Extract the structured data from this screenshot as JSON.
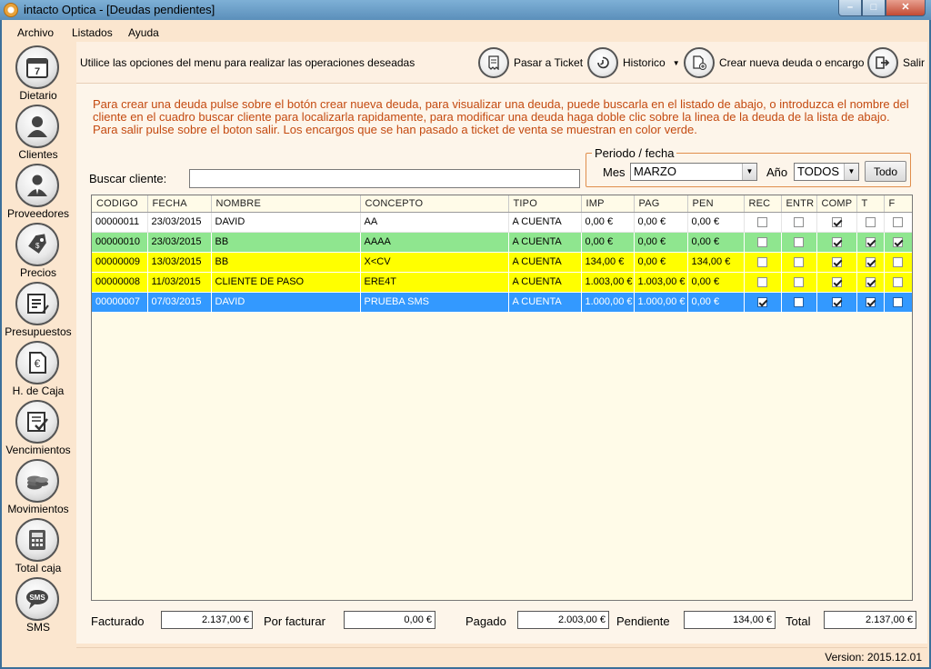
{
  "window": {
    "title": "intacto Optica - [Deudas pendientes]"
  },
  "menu": [
    "Archivo",
    "Listados",
    "Ayuda"
  ],
  "sidebar": [
    {
      "label": "Dietario",
      "icon": "calendar-icon"
    },
    {
      "label": "Clientes",
      "icon": "person-icon"
    },
    {
      "label": "Proveedores",
      "icon": "businessman-icon"
    },
    {
      "label": "Precios",
      "icon": "price-tag-icon"
    },
    {
      "label": "Presupuestos",
      "icon": "notepad-icon"
    },
    {
      "label": "H. de Caja",
      "icon": "euro-document-icon"
    },
    {
      "label": "Vencimientos",
      "icon": "checklist-icon"
    },
    {
      "label": "Movimientos",
      "icon": "coins-icon"
    },
    {
      "label": "Total caja",
      "icon": "calculator-icon"
    },
    {
      "label": "SMS",
      "icon": "sms-bubble-icon"
    }
  ],
  "toolbar": {
    "hint": "Utilice las opciones del menu para realizar las operaciones deseadas",
    "pasar_ticket": "Pasar a Ticket",
    "historico": "Historico",
    "crear": "Crear nueva deuda o encargo",
    "salir": "Salir"
  },
  "instructions": "Para crear una deuda pulse sobre el botón crear nueva deuda, para visualizar una deuda, puede buscarla en el listado de abajo, o introduzca el nombre del cliente en el cuadro buscar cliente para localizarla rapidamente, para modificar una deuda haga doble clic sobre la linea de la deuda de la lista de abajo. Para salir pulse sobre el boton salir. Los encargos que se han pasado a ticket de venta se muestran en color verde.",
  "search": {
    "label": "Buscar cliente:",
    "value": ""
  },
  "periodo": {
    "legend": "Periodo / fecha",
    "mes_label": "Mes",
    "mes_value": "MARZO",
    "ano_label": "Año",
    "ano_value": "TODOS",
    "todo_button": "Todo"
  },
  "table": {
    "columns": [
      "CODIGO",
      "FECHA",
      "NOMBRE",
      "CONCEPTO",
      "TIPO",
      "IMP",
      "PAG",
      "PEN",
      "REC",
      "ENTR",
      "COMP",
      "T",
      "F"
    ],
    "rows": [
      {
        "codigo": "00000011",
        "fecha": "23/03/2015",
        "nombre": "DAVID",
        "concepto": "AA",
        "tipo": "A CUENTA",
        "imp": "0,00 €",
        "pag": "0,00 €",
        "pen": "0,00 €",
        "rec": false,
        "entr": false,
        "comp": true,
        "t": false,
        "f": false,
        "color": "white"
      },
      {
        "codigo": "00000010",
        "fecha": "23/03/2015",
        "nombre": "BB",
        "concepto": "AAAA",
        "tipo": "A CUENTA",
        "imp": "0,00 €",
        "pag": "0,00 €",
        "pen": "0,00 €",
        "rec": false,
        "entr": false,
        "comp": true,
        "t": true,
        "f": true,
        "color": "green"
      },
      {
        "codigo": "00000009",
        "fecha": "13/03/2015",
        "nombre": "BB",
        "concepto": "X<CV",
        "tipo": "A CUENTA",
        "imp": "134,00 €",
        "pag": "0,00 €",
        "pen": "134,00 €",
        "rec": false,
        "entr": false,
        "comp": true,
        "t": true,
        "f": false,
        "color": "yellow"
      },
      {
        "codigo": "00000008",
        "fecha": "11/03/2015",
        "nombre": "CLIENTE DE PASO",
        "concepto": "ERE4T",
        "tipo": "A CUENTA",
        "imp": "1.003,00 €",
        "pag": "1.003,00 €",
        "pen": "0,00 €",
        "rec": false,
        "entr": false,
        "comp": true,
        "t": true,
        "f": false,
        "color": "yellow"
      },
      {
        "codigo": "00000007",
        "fecha": "07/03/2015",
        "nombre": "DAVID",
        "concepto": "PRUEBA SMS",
        "tipo": "A CUENTA",
        "imp": "1.000,00 €",
        "pag": "1.000,00 €",
        "pen": "0,00 €",
        "rec": true,
        "entr": false,
        "comp": true,
        "t": true,
        "f": false,
        "color": "blue"
      }
    ]
  },
  "totals": {
    "facturado_label": "Facturado",
    "facturado": "2.137,00 €",
    "por_facturar_label": "Por facturar",
    "por_facturar": "0,00 €",
    "pagado_label": "Pagado",
    "pagado": "2.003,00 €",
    "pendiente_label": "Pendiente",
    "pendiente": "134,00 €",
    "total_label": "Total",
    "total": "2.137,00 €"
  },
  "status": {
    "version": "Version: 2015.12.01"
  }
}
